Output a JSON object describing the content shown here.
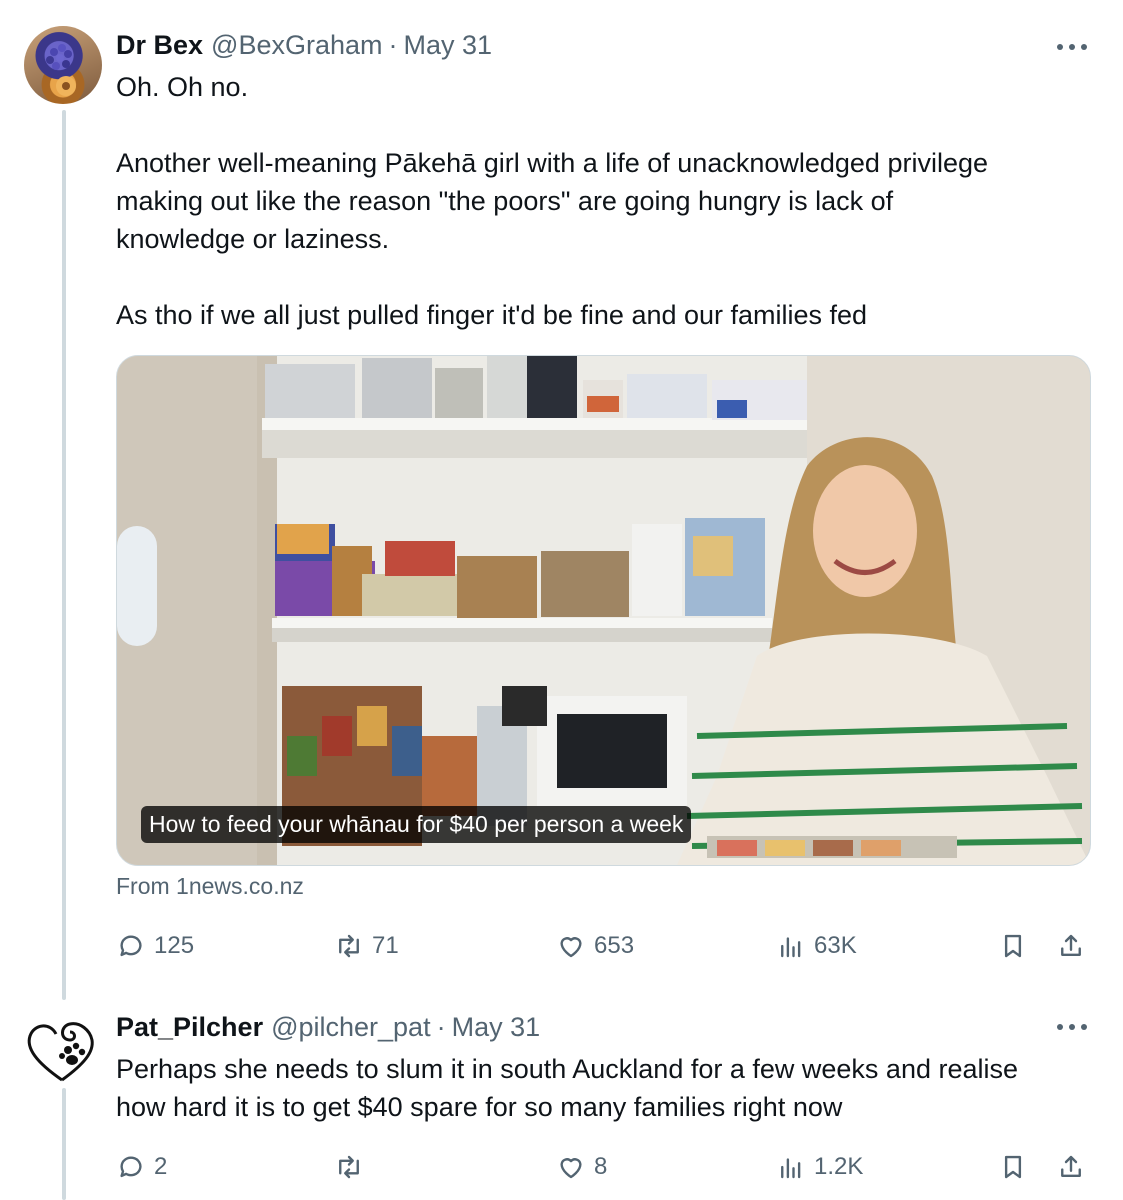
{
  "tweet1": {
    "name": "Dr Bex",
    "handle": "@BexGraham",
    "dot": "·",
    "date": "May 31",
    "text_lines": [
      "Oh. Oh no.",
      "Another well-meaning Pākehā girl with a life of unacknowledged privilege",
      "making out like the reason \"the poors\" are going hungry is lack of",
      "knowledge or laziness.",
      "As tho if we all just pulled finger it'd be fine and our families fed"
    ],
    "media_caption": "How to feed your whānau for $40 per person a week",
    "source": "From 1news.co.nz",
    "stats": {
      "replies": "125",
      "retweets": "71",
      "likes": "653",
      "views": "63K"
    }
  },
  "tweet2": {
    "name": "Pat_Pilcher",
    "handle": "@pilcher_pat",
    "dot": "·",
    "date": "May 31",
    "text_lines": [
      "Perhaps she needs to slum it in south Auckland for a few weeks and realise",
      "how hard it is to get $40 spare for so many families right now"
    ],
    "stats": {
      "replies": "2",
      "retweets": "",
      "likes": "8",
      "views": "1.2K"
    }
  },
  "icons": [
    "more-icon",
    "reply-icon",
    "retweet-icon",
    "like-icon",
    "views-icon",
    "bookmark-icon",
    "share-icon"
  ],
  "colors": {
    "text": "#0f1419",
    "secondary": "#536471",
    "thread_line": "#cfd9de"
  }
}
